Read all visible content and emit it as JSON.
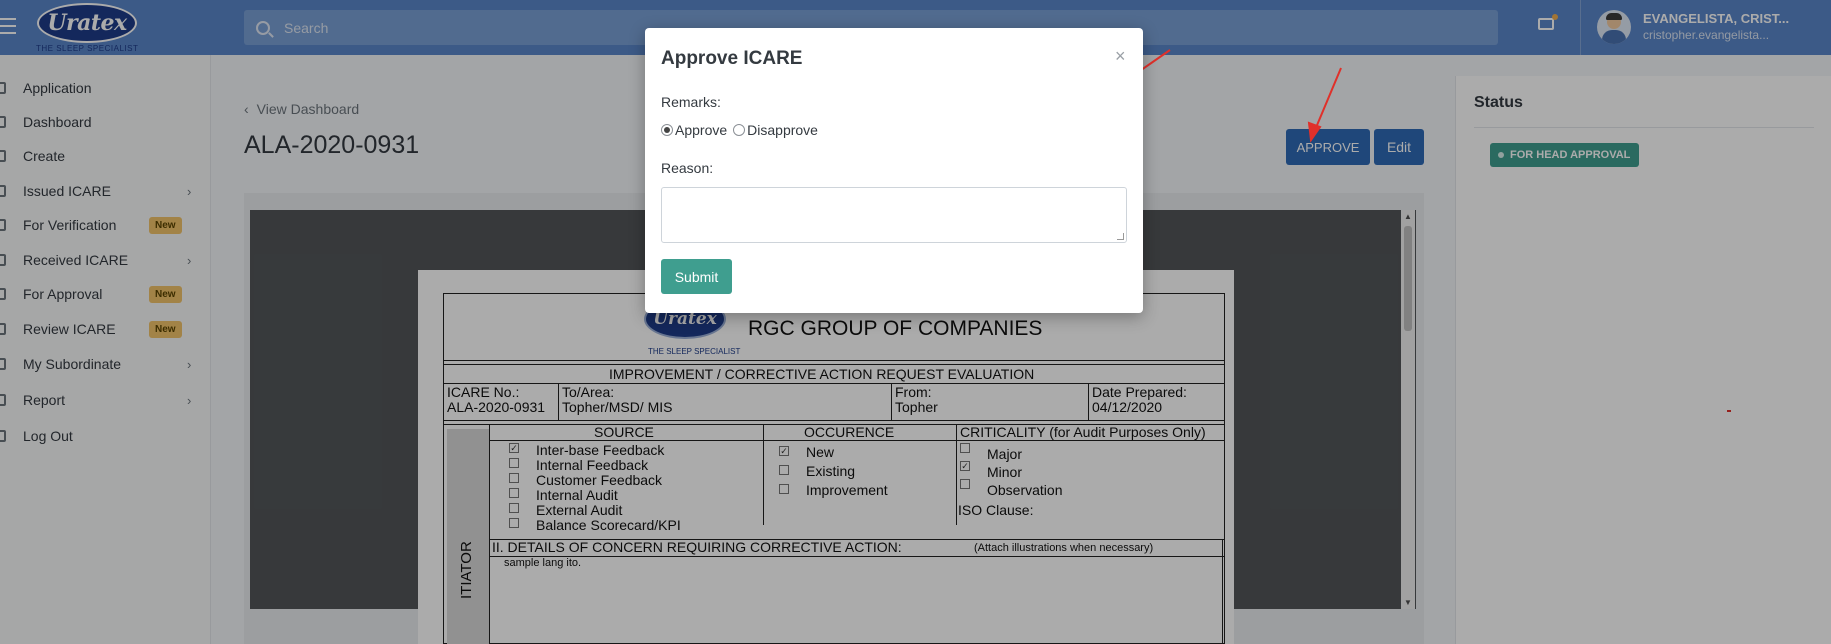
{
  "header": {
    "logo_text": "Uratex",
    "logo_sub": "THE SLEEP SPECIALIST",
    "search_placeholder": "Search",
    "icons": [
      "menu-icon",
      "search-icon",
      "mail-icon"
    ],
    "user_name": "EVANGELISTA, CRIST...",
    "user_email": "cristopher.evangelista..."
  },
  "sidebar": {
    "items": [
      {
        "label": "Application",
        "chevron": "",
        "badge": ""
      },
      {
        "label": "Dashboard",
        "chevron": "",
        "badge": ""
      },
      {
        "label": "Create",
        "chevron": "",
        "badge": ""
      },
      {
        "label": "Issued ICARE",
        "chevron": "›",
        "badge": ""
      },
      {
        "label": "For Verification",
        "chevron": "",
        "badge": "New"
      },
      {
        "label": "Received ICARE",
        "chevron": "›",
        "badge": ""
      },
      {
        "label": "For Approval",
        "chevron": "",
        "badge": "New"
      },
      {
        "label": "Review ICARE",
        "chevron": "",
        "badge": "New"
      },
      {
        "label": "My Subordinate",
        "chevron": "›",
        "badge": ""
      },
      {
        "label": "Report",
        "chevron": "›",
        "badge": ""
      },
      {
        "label": "Log Out",
        "chevron": "",
        "badge": ""
      }
    ]
  },
  "main": {
    "breadcrumb": "View Dashboard",
    "title": "ALA-2020-0931",
    "approve_label": "APPROVE",
    "edit_label": "Edit"
  },
  "document": {
    "logo_text": "Uratex",
    "logo_sub": "THE SLEEP SPECIALIST",
    "company": "RGC GROUP OF COMPANIES",
    "form_title": "IMPROVEMENT / CORRECTIVE ACTION REQUEST EVALUATION",
    "icare_no_label": "ICARE No.:",
    "icare_no": "ALA-2020-0931",
    "to_area_label": "To/Area:",
    "to_area": "Topher/MSD/ MIS",
    "from_label": "From:",
    "from": "Topher",
    "date_label": "Date Prepared:",
    "date": "04/12/2020",
    "source_header": "SOURCE",
    "occurence_header": "OCCURENCE",
    "criticality_header": "CRITICALITY (for Audit Purposes Only)",
    "sources": [
      {
        "label": "Inter-base Feedback",
        "checked": "✓"
      },
      {
        "label": "Internal Feedback",
        "checked": ""
      },
      {
        "label": "Customer Feedback",
        "checked": ""
      },
      {
        "label": "Internal Audit",
        "checked": ""
      },
      {
        "label": "External Audit",
        "checked": ""
      },
      {
        "label": "Balance Scorecard/KPI",
        "checked": ""
      }
    ],
    "occurences": [
      {
        "label": "New",
        "checked": "✓"
      },
      {
        "label": "Existing",
        "checked": ""
      },
      {
        "label": "Improvement",
        "checked": ""
      }
    ],
    "criticalities": [
      {
        "label": "Major",
        "checked": ""
      },
      {
        "label": "Minor",
        "checked": "✓"
      },
      {
        "label": "Observation",
        "checked": ""
      }
    ],
    "iso_clause": "ISO Clause:",
    "details_header": "II. DETAILS OF CONCERN REQUIRING CORRECTIVE ACTION:",
    "details_note": "(Attach illustrations when necessary)",
    "details_text": "sample lang ito.",
    "initiator_label": "ITIATOR"
  },
  "status_panel": {
    "title": "Status",
    "badge": "FOR HEAD APPROVAL",
    "badge_color": "#3f9e8f"
  },
  "modal": {
    "title": "Approve ICARE",
    "close": "×",
    "remarks_label": "Remarks:",
    "option_approve": "Approve",
    "option_disapprove": "Disapprove",
    "selected": "Approve",
    "reason_label": "Reason:",
    "reason_value": "",
    "submit_label": "Submit"
  },
  "colors": {
    "topbar": "#5a86c9",
    "primary": "#2f6bb7",
    "success": "#3f9e8f",
    "badge_new": "#f2c46a",
    "annotation_arrow": "#e0302a"
  }
}
